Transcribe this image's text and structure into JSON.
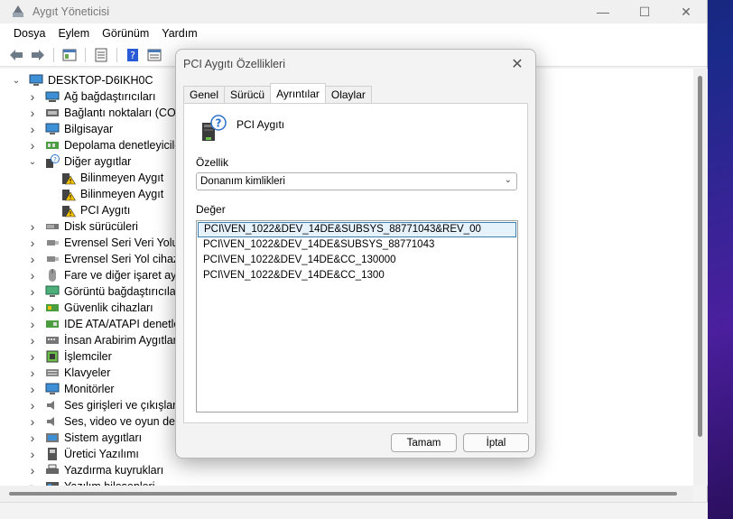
{
  "window": {
    "title": "Aygıt Yöneticisi",
    "minimize_glyph": "—",
    "maximize_glyph": "☐",
    "close_glyph": "✕"
  },
  "menu": {
    "items": [
      "Dosya",
      "Eylem",
      "Görünüm",
      "Yardım"
    ]
  },
  "tree": {
    "root": "DESKTOP-D6IKH0C",
    "items": [
      {
        "label": "Ağ bağdaştırıcıları",
        "icon": "network-adapter-icon",
        "level": 1,
        "expander": "collapsed"
      },
      {
        "label": "Bağlantı noktaları (COM",
        "icon": "port-icon",
        "level": 1,
        "expander": "collapsed"
      },
      {
        "label": "Bilgisayar",
        "icon": "computer-icon",
        "level": 1,
        "expander": "collapsed"
      },
      {
        "label": "Depolama denetleyiciler",
        "icon": "storage-controller-icon",
        "level": 1,
        "expander": "collapsed"
      },
      {
        "label": "Diğer aygıtlar",
        "icon": "unknown-device-icon",
        "level": 1,
        "expander": "expanded"
      },
      {
        "label": "Bilinmeyen Aygıt",
        "icon": "warning-device-icon",
        "level": 2,
        "expander": "none"
      },
      {
        "label": "Bilinmeyen Aygıt",
        "icon": "warning-device-icon",
        "level": 2,
        "expander": "none"
      },
      {
        "label": "PCI Aygıtı",
        "icon": "warning-device-icon",
        "level": 2,
        "expander": "none"
      },
      {
        "label": "Disk sürücüleri",
        "icon": "disk-drive-icon",
        "level": 1,
        "expander": "collapsed"
      },
      {
        "label": "Evrensel Seri Veri Yolu de",
        "icon": "usb-icon",
        "level": 1,
        "expander": "collapsed"
      },
      {
        "label": "Evrensel Seri Yol cihazlar",
        "icon": "usb-icon",
        "level": 1,
        "expander": "collapsed"
      },
      {
        "label": "Fare ve diğer işaret aygıt",
        "icon": "mouse-icon",
        "level": 1,
        "expander": "collapsed"
      },
      {
        "label": "Görüntü bağdaştırıcıları",
        "icon": "display-adapter-icon",
        "level": 1,
        "expander": "collapsed"
      },
      {
        "label": "Güvenlik cihazları",
        "icon": "security-device-icon",
        "level": 1,
        "expander": "collapsed"
      },
      {
        "label": "IDE ATA/ATAPI denetley",
        "icon": "ide-controller-icon",
        "level": 1,
        "expander": "collapsed"
      },
      {
        "label": "İnsan Arabirim Aygıtları",
        "icon": "hid-icon",
        "level": 1,
        "expander": "collapsed"
      },
      {
        "label": "İşlemciler",
        "icon": "processor-icon",
        "level": 1,
        "expander": "collapsed"
      },
      {
        "label": "Klavyeler",
        "icon": "keyboard-icon",
        "level": 1,
        "expander": "collapsed"
      },
      {
        "label": "Monitörler",
        "icon": "monitor-icon",
        "level": 1,
        "expander": "collapsed"
      },
      {
        "label": "Ses girişleri ve çıkışları",
        "icon": "speaker-icon",
        "level": 1,
        "expander": "collapsed"
      },
      {
        "label": "Ses, video ve oyun dene",
        "icon": "speaker-icon",
        "level": 1,
        "expander": "collapsed"
      },
      {
        "label": "Sistem aygıtları",
        "icon": "system-device-icon",
        "level": 1,
        "expander": "collapsed"
      },
      {
        "label": "Üretici Yazılımı",
        "icon": "firmware-icon",
        "level": 1,
        "expander": "collapsed"
      },
      {
        "label": "Yazdırma kuyrukları",
        "icon": "printer-icon",
        "level": 1,
        "expander": "collapsed"
      },
      {
        "label": "Yazılım bileşenleri",
        "icon": "software-component-icon",
        "level": 1,
        "expander": "collapsed"
      }
    ]
  },
  "dialog": {
    "title": "PCI Aygıtı Özellikleri",
    "close_glyph": "✕",
    "tabs": [
      {
        "label": "Genel",
        "active": false
      },
      {
        "label": "Sürücü",
        "active": false
      },
      {
        "label": "Ayrıntılar",
        "active": true
      },
      {
        "label": "Olaylar",
        "active": false
      }
    ],
    "device_name": "PCI Aygıtı",
    "property_label": "Özellik",
    "property_value": "Donanım kimlikleri",
    "value_label": "Değer",
    "values": [
      "PCI\\VEN_1022&DEV_14DE&SUBSYS_88771043&REV_00",
      "PCI\\VEN_1022&DEV_14DE&SUBSYS_88771043",
      "PCI\\VEN_1022&DEV_14DE&CC_130000",
      "PCI\\VEN_1022&DEV_14DE&CC_1300"
    ],
    "selected_index": 0,
    "ok_label": "Tamam",
    "cancel_label": "İptal"
  },
  "colors": {
    "selection_border": "#3c7fb1",
    "selection_fill": "#e5f1fb",
    "warning": "#f2c200"
  }
}
